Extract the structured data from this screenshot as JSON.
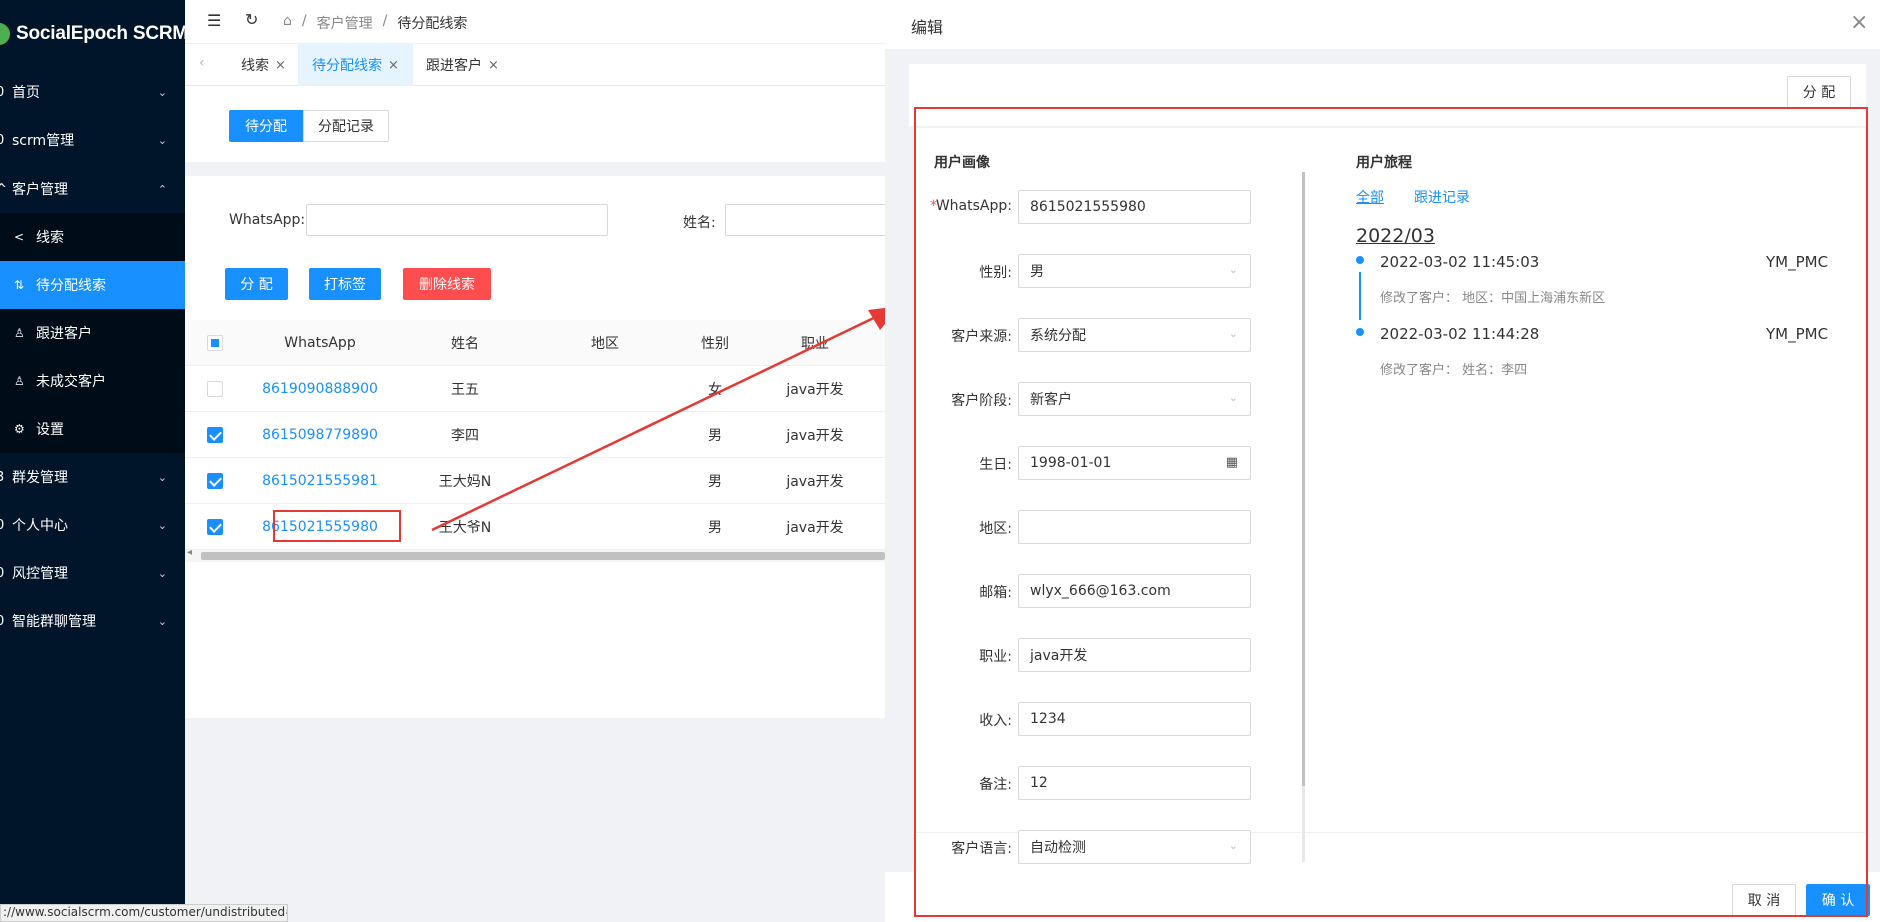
{
  "app": {
    "name": "SocialEpoch SCRM"
  },
  "sidebar": {
    "items": [
      {
        "label": "首页",
        "lead": "0"
      },
      {
        "label": "scrm管理",
        "lead": "0"
      },
      {
        "label": "客户管理",
        "lead": "^"
      },
      {
        "label": "群发管理",
        "lead": "3"
      },
      {
        "label": "个人中心",
        "lead": "0"
      },
      {
        "label": "风控管理",
        "lead": "0"
      },
      {
        "label": "智能群聊管理",
        "lead": "0"
      }
    ],
    "sub_items": [
      {
        "label": "线索"
      },
      {
        "label": "待分配线索"
      },
      {
        "label": "跟进客户"
      },
      {
        "label": "未成交客户"
      },
      {
        "label": "设置"
      }
    ]
  },
  "breadcrumb": {
    "home": "⌂",
    "sep": "/",
    "parent": "客户管理",
    "current": "待分配线索"
  },
  "tabs": [
    {
      "label": "线索"
    },
    {
      "label": "待分配线索"
    },
    {
      "label": "跟进客户"
    }
  ],
  "segmented": {
    "pending": "待分配",
    "records": "分配记录"
  },
  "search": {
    "whatsapp_label": "WhatsApp:",
    "name_label": "姓名:"
  },
  "actions": {
    "assign": "分 配",
    "tag": "打标签",
    "delete": "删除线索"
  },
  "table": {
    "headers": [
      "WhatsApp",
      "姓名",
      "地区",
      "性别",
      "职业"
    ],
    "rows": [
      {
        "whatsapp": "8619090888900",
        "name": "王五",
        "region": "",
        "gender": "女",
        "job": "java开发",
        "checked": false
      },
      {
        "whatsapp": "8615098779890",
        "name": "李四",
        "region": "",
        "gender": "男",
        "job": "java开发",
        "checked": true
      },
      {
        "whatsapp": "8615021555981",
        "name": "王大妈N",
        "region": "",
        "gender": "男",
        "job": "java开发",
        "checked": true
      },
      {
        "whatsapp": "8615021555980",
        "name": "王大爷N",
        "region": "",
        "gender": "男",
        "job": "java开发",
        "checked": true
      }
    ]
  },
  "status_bar": {
    "url": "://www.socialscrm.com/customer/undistributed#"
  },
  "drawer": {
    "title": "编辑",
    "close": "×",
    "assign_button": "分 配",
    "profile_title": "用户画像",
    "journey_title": "用户旅程",
    "fields": [
      {
        "label": "WhatsApp:",
        "value": "8615021555980",
        "type": "input",
        "required": true
      },
      {
        "label": "性别:",
        "value": "男",
        "type": "select"
      },
      {
        "label": "客户来源:",
        "value": "系统分配",
        "type": "select"
      },
      {
        "label": "客户阶段:",
        "value": "新客户",
        "type": "select"
      },
      {
        "label": "生日:",
        "value": "1998-01-01",
        "type": "date"
      },
      {
        "label": "地区:",
        "value": "",
        "type": "input"
      },
      {
        "label": "邮箱:",
        "value": "wlyx_666@163.com",
        "type": "input"
      },
      {
        "label": "职业:",
        "value": "java开发",
        "type": "input"
      },
      {
        "label": "收入:",
        "value": "1234",
        "type": "input"
      },
      {
        "label": "备注:",
        "value": "12",
        "type": "input"
      },
      {
        "label": "客户语言:",
        "value": "自动检测",
        "type": "select"
      }
    ],
    "journey": {
      "filters": [
        "全部",
        "跟进记录"
      ],
      "month": "2022/03",
      "events": [
        {
          "time": "2022-03-02 11:45:03",
          "user": "YM_PMC",
          "desc": "修改了客户： 地区：中国上海浦东新区"
        },
        {
          "time": "2022-03-02 11:44:28",
          "user": "YM_PMC",
          "desc": "修改了客户： 姓名：李四"
        }
      ]
    },
    "footer": {
      "cancel": "取 消",
      "confirm": "确 认"
    }
  },
  "colors": {
    "primary": "#1890ff",
    "danger": "#ff4d4f",
    "sidebar": "#001529",
    "highlight": "#e53935"
  }
}
